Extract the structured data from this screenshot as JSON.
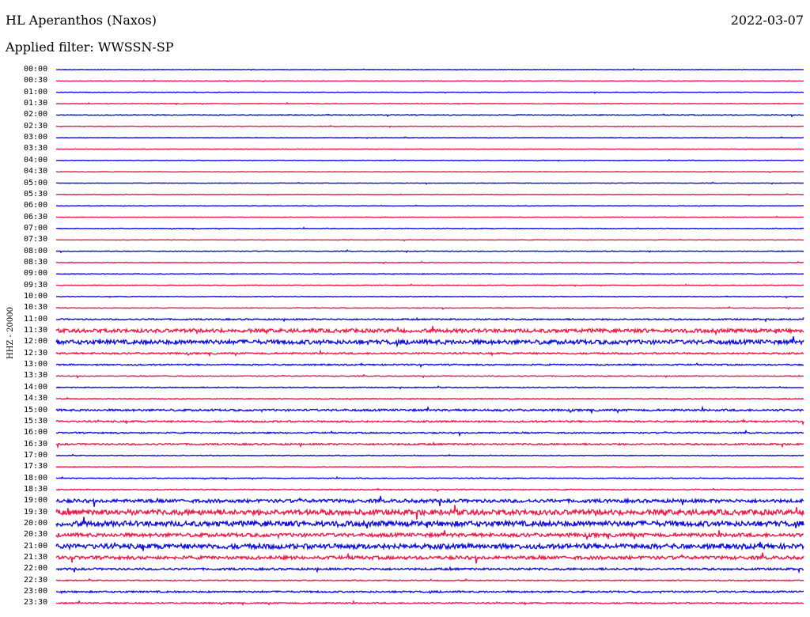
{
  "header": {
    "station": "HL Aperanthos (Naxos)",
    "date": "2022-03-07",
    "filter_label": "Applied filter: WWSSN-SP"
  },
  "channel_label": "HHZ - 20000",
  "colors": {
    "trace_a": "#1010e0",
    "trace_b": "#ee1c4a",
    "background": "#ffffff"
  },
  "chart_data": {
    "type": "helicorder",
    "row_labels": [
      "00:00",
      "00:30",
      "01:00",
      "01:30",
      "02:00",
      "02:30",
      "03:00",
      "03:30",
      "04:00",
      "04:30",
      "05:00",
      "05:30",
      "06:00",
      "06:30",
      "07:00",
      "07:30",
      "08:00",
      "08:30",
      "09:00",
      "09:30",
      "10:00",
      "10:30",
      "11:00",
      "11:30",
      "12:00",
      "12:30",
      "13:00",
      "13:30",
      "14:00",
      "14:30",
      "15:00",
      "15:30",
      "16:00",
      "16:30",
      "17:00",
      "17:30",
      "18:00",
      "18:30",
      "19:00",
      "19:30",
      "20:00",
      "20:30",
      "21:00",
      "21:30",
      "22:00",
      "22:30",
      "23:00",
      "23:30"
    ],
    "noise_level": [
      0.3,
      0.3,
      0.3,
      0.4,
      0.5,
      0.3,
      0.3,
      0.3,
      0.3,
      0.3,
      0.3,
      0.3,
      0.3,
      0.3,
      0.4,
      0.3,
      0.4,
      0.4,
      0.4,
      0.4,
      0.4,
      0.4,
      0.8,
      2.2,
      2.6,
      1.0,
      0.8,
      0.5,
      0.5,
      0.5,
      1.2,
      1.0,
      0.8,
      1.0,
      0.4,
      0.4,
      0.5,
      0.6,
      2.0,
      3.2,
      3.2,
      2.2,
      3.0,
      2.0,
      1.2,
      0.6,
      1.0,
      0.8
    ]
  }
}
